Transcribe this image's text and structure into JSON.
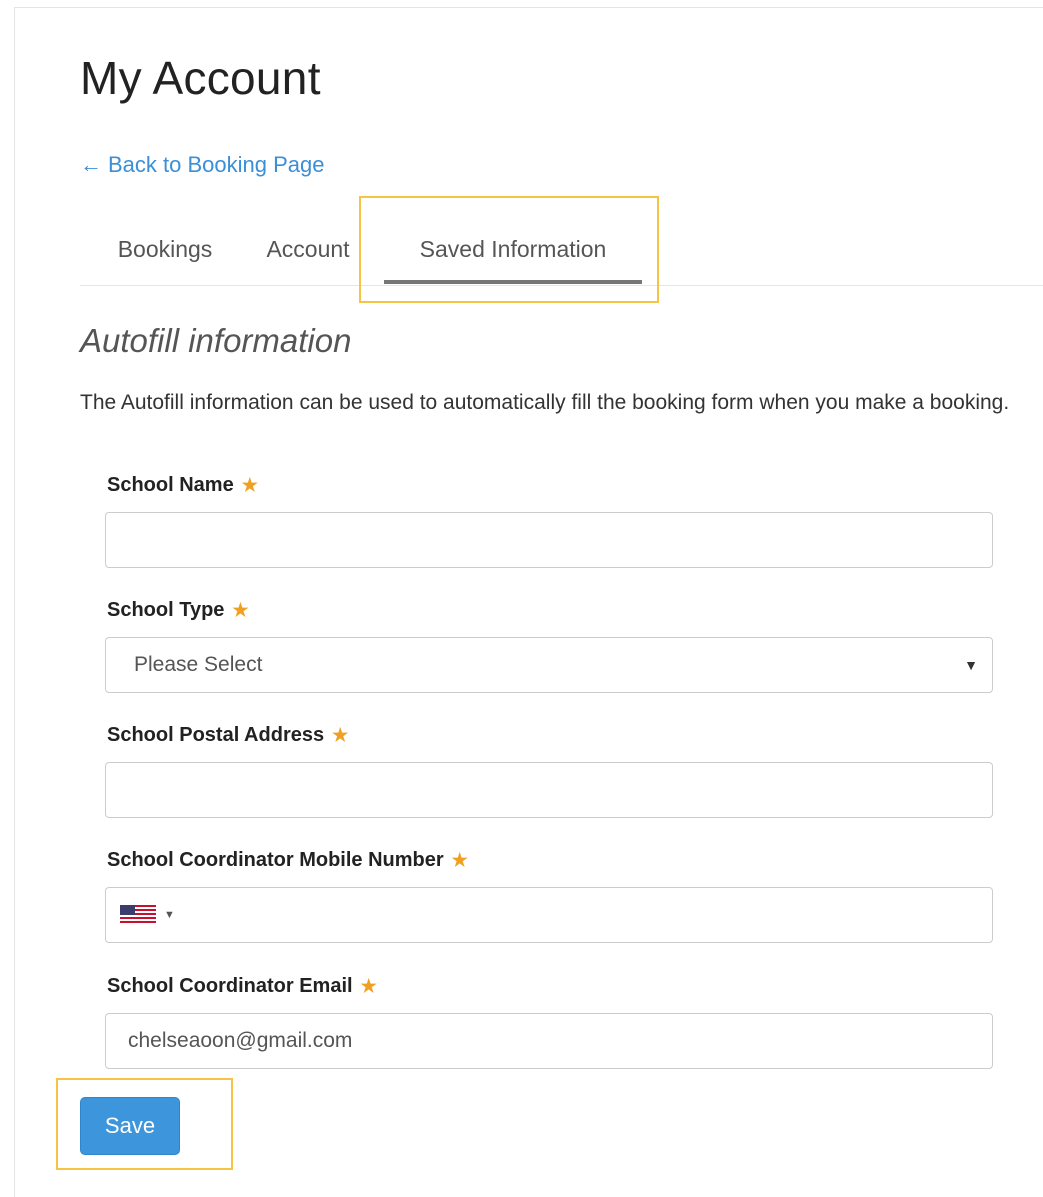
{
  "page": {
    "title": "My Account"
  },
  "back_link": {
    "label": "Back to Booking Page",
    "icon": "arrow-left-icon"
  },
  "tabs": [
    {
      "label": "Bookings",
      "active": false
    },
    {
      "label": "Account",
      "active": false
    },
    {
      "label": "Saved Information",
      "active": true
    }
  ],
  "section": {
    "title": "Autofill information",
    "description": "The Autofill information can be used to automatically fill the booking form when you make a booking."
  },
  "form": {
    "required_marker": "★",
    "school_name": {
      "label": "School Name",
      "value": ""
    },
    "school_type": {
      "label": "School Type",
      "selected": "Please Select"
    },
    "school_postal_address": {
      "label": "School Postal Address",
      "value": ""
    },
    "coordinator_mobile": {
      "label": "School Coordinator Mobile Number",
      "country_flag": "us-flag-icon",
      "value": ""
    },
    "coordinator_email": {
      "label": "School Coordinator Email",
      "value": "chelseaoon@gmail.com"
    }
  },
  "save_button": {
    "label": "Save"
  },
  "colors": {
    "link": "#3a8fd8",
    "required": "#f0a020",
    "primary_button": "#3d96dc",
    "highlight": "#f6c443",
    "active_tab_underline": "#777777"
  }
}
